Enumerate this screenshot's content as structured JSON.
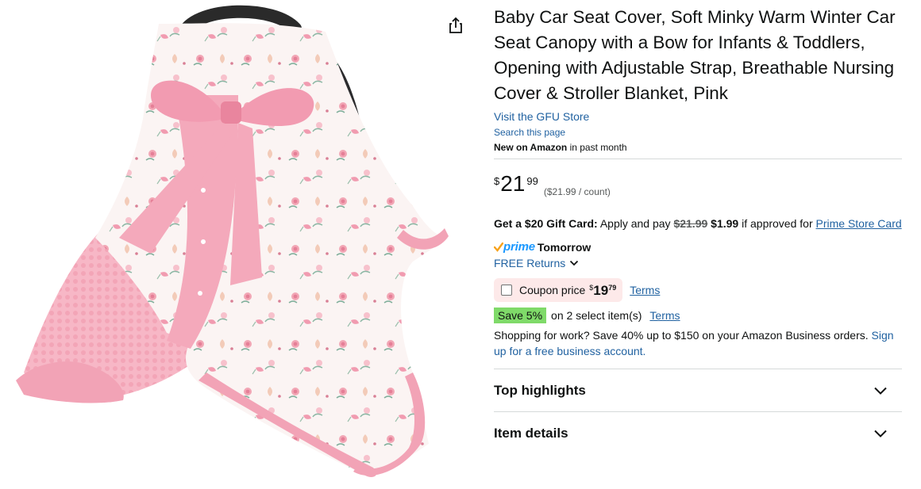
{
  "product": {
    "title": "Baby Car Seat Cover, Soft Minky Warm Winter Car Seat Canopy with a Bow for Infants & Toddlers, Opening with Adjustable Strap, Breathable Nursing Cover & Stroller Blanket, Pink",
    "store_link": "Visit the GFU Store",
    "search_link": "Search this page",
    "new_label": "New on Amazon",
    "new_suffix": " in past month",
    "image_icon": "baby-car-seat-cover-image"
  },
  "share": {
    "icon": "share-icon"
  },
  "price": {
    "symbol": "$",
    "whole": "21",
    "fraction": "99",
    "unit_price": "($21.99 / count)"
  },
  "gift_card": {
    "bold": "Get a $20 Gift Card:",
    "text1": " Apply and pay ",
    "strike": "$21.99",
    "sale": " $1.99",
    "text2": " if approved for ",
    "link": "Prime Store Card"
  },
  "delivery": {
    "prime": "prime",
    "day": "Tomorrow",
    "returns": "FREE Returns"
  },
  "coupon": {
    "label": "Coupon price",
    "symbol": "$",
    "whole": "19",
    "fraction": "79",
    "terms": "Terms"
  },
  "save": {
    "badge": "Save 5%",
    "text": "on 2 select item(s)",
    "terms": "Terms"
  },
  "business": {
    "text": "Shopping for work? Save 40% up to $150 on your Amazon Business orders. ",
    "link": "Sign up for a free business account."
  },
  "sections": [
    {
      "title": "Top highlights"
    },
    {
      "title": "Item details"
    }
  ],
  "colors": {
    "link": "#2162a1",
    "prime": "#1a98ff",
    "save_badge": "#7fda69",
    "coupon_bg": "#fde9e9",
    "product_pink": "#f5b3c4"
  }
}
